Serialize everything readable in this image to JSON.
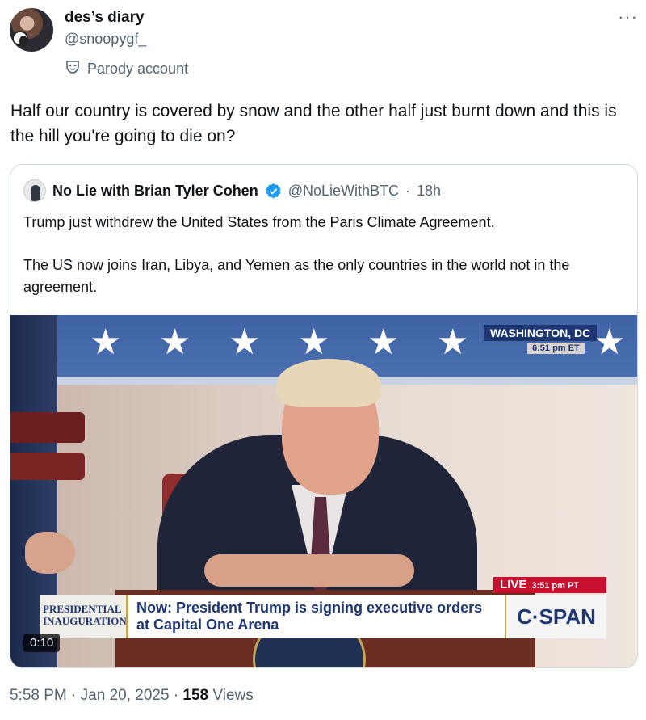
{
  "author": {
    "display_name": "des’s diary",
    "handle": "@snoopygf_",
    "label": "Parody account"
  },
  "tweet": {
    "text": "Half our country is covered by snow and the other half just burnt down and this is the hill you're going to die on?"
  },
  "quoted": {
    "name": "No Lie with Brian Tyler Cohen",
    "handle": "@NoLieWithBTC",
    "dot": "·",
    "time": "18h",
    "text_line1": "Trump just withdrew the United States from the Paris Climate Agreement.",
    "text_line2": "The US now joins Iran, Libya, and Yemen as the only countries in the world not in the agreement.",
    "media": {
      "location": "WASHINGTON, DC",
      "location_time": "6:51 pm ET",
      "live": "LIVE",
      "live_time": "3:51 pm PT",
      "program": "PRESIDENTIAL INAUGURATION",
      "ticker": "Now: President Trump is signing executive orders at Capital One Arena",
      "network": "C·SPAN",
      "duration": "0:10"
    }
  },
  "footer": {
    "time": "5:58 PM",
    "dot1": "·",
    "date": "Jan 20, 2025",
    "dot2": "·",
    "views_count": "158",
    "views_label": "Views"
  },
  "colors": {
    "secondary_text": "#536471",
    "verified_blue": "#1d9bf0"
  },
  "icons": {
    "more": "more-icon",
    "parody": "parody-mask-icon",
    "verified": "verified-badge-icon"
  }
}
